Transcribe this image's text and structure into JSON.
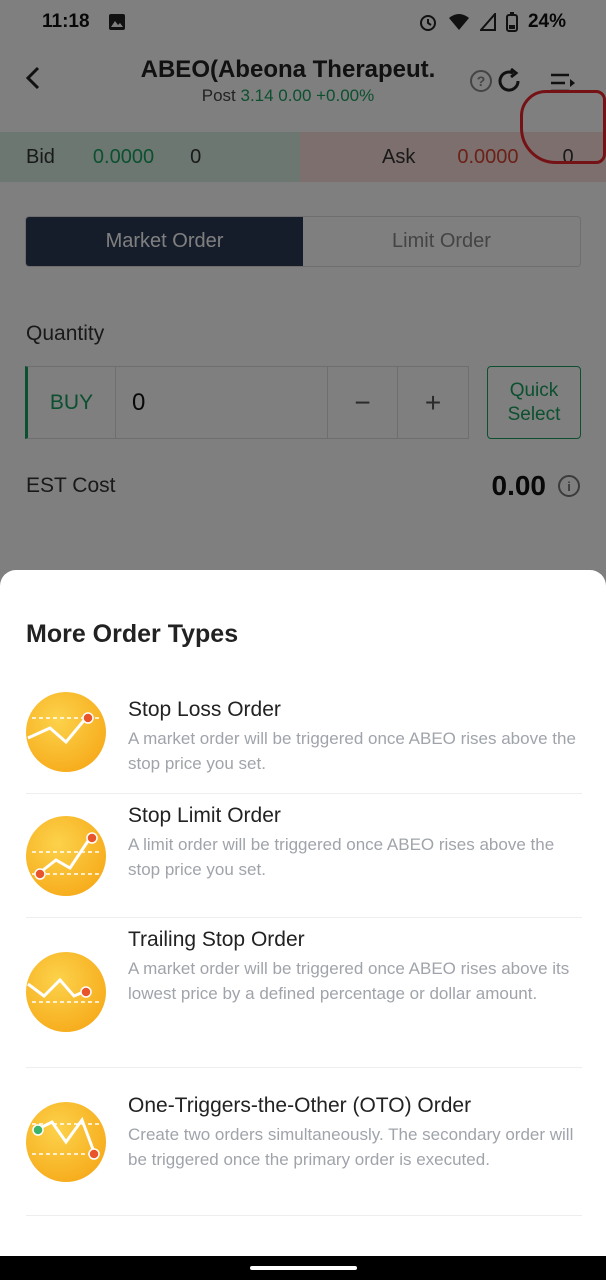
{
  "status_bar": {
    "time": "11:18",
    "battery": "24%"
  },
  "header": {
    "title": "ABEO(Abeona Therapeut.",
    "help": "?",
    "post_label": "Post",
    "post_values": "3.14 0.00 +0.00%"
  },
  "bid_ask": {
    "bid_label": "Bid",
    "bid_value": "0.0000",
    "bid_qty": "0",
    "ask_label": "Ask",
    "ask_value": "0.0000",
    "ask_qty": "0"
  },
  "order_tabs": [
    "Market Order",
    "Limit Order"
  ],
  "quantity": {
    "label": "Quantity",
    "side": "BUY",
    "value": "0",
    "minus": "−",
    "plus": "+",
    "quick_select": "Quick Select"
  },
  "est_cost": {
    "label": "EST Cost",
    "value": "0.00",
    "info": "i"
  },
  "sheet": {
    "title": "More Order Types",
    "options": [
      {
        "name": "Stop Loss Order",
        "desc": "A market order will be triggered once ABEO rises above the stop price you set."
      },
      {
        "name": "Stop Limit Order",
        "desc": "A limit order will be triggered once ABEO rises above the stop price you set."
      },
      {
        "name": "Trailing Stop Order",
        "desc": "A market order will be triggered once ABEO rises above its lowest price by a defined percentage or dollar amount."
      },
      {
        "name": "One-Triggers-the-Other (OTO) Order",
        "desc": "Create two orders simultaneously. The secondary order will be triggered once the primary order is executed."
      }
    ]
  },
  "colors": {
    "accent_green": "#18a060",
    "ask_red": "#d7422f",
    "tab_active": "#2b3a55",
    "icon_orange": "#f5a10e"
  }
}
